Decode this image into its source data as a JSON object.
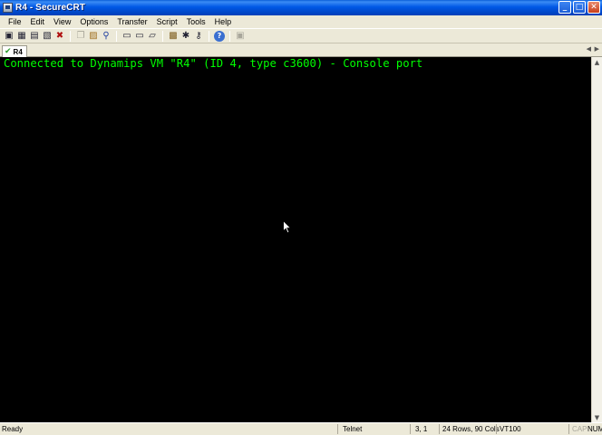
{
  "window": {
    "title": "R4 - SecureCRT",
    "minimize_glyph": "_",
    "maximize_glyph": "□",
    "close_glyph": "✕"
  },
  "menu": {
    "items": [
      "File",
      "Edit",
      "View",
      "Options",
      "Transfer",
      "Script",
      "Tools",
      "Help"
    ]
  },
  "toolbar": {
    "icons": [
      {
        "name": "connect-icon",
        "glyph": "▣"
      },
      {
        "name": "quick-connect-icon",
        "glyph": "▦"
      },
      {
        "name": "connect-tab-icon",
        "glyph": "▤"
      },
      {
        "name": "reconnect-icon",
        "glyph": "▧"
      },
      {
        "name": "disconnect-icon",
        "glyph": "✖"
      },
      {
        "name": "copy-icon",
        "glyph": "❐"
      },
      {
        "name": "paste-icon",
        "glyph": "▨"
      },
      {
        "name": "find-icon",
        "glyph": "⚲"
      },
      {
        "name": "print-icon",
        "glyph": "▭"
      },
      {
        "name": "print-setup-icon",
        "glyph": "▭"
      },
      {
        "name": "log-session-icon",
        "glyph": "▱"
      },
      {
        "name": "session-options-icon",
        "glyph": "▩"
      },
      {
        "name": "global-options-icon",
        "glyph": "✱"
      },
      {
        "name": "keymap-icon",
        "glyph": "⚷"
      },
      {
        "name": "help-icon",
        "glyph": "?"
      },
      {
        "name": "sftp-icon",
        "glyph": "▣"
      }
    ]
  },
  "tabs": [
    {
      "label": "R4",
      "status_glyph": "✔"
    }
  ],
  "terminal": {
    "lines": [
      "Connected to Dynamips VM \"R4\" (ID 4, type c3600) - Console port"
    ],
    "fg_color": "#00ff00",
    "bg_color": "#000000"
  },
  "status": {
    "ready": "Ready",
    "protocol": "Telnet",
    "cursor_pos": "3,  1",
    "size": "24 Rows,  90 Cols",
    "emulation": "VT100",
    "caps": "CAP",
    "num": "NUM"
  }
}
